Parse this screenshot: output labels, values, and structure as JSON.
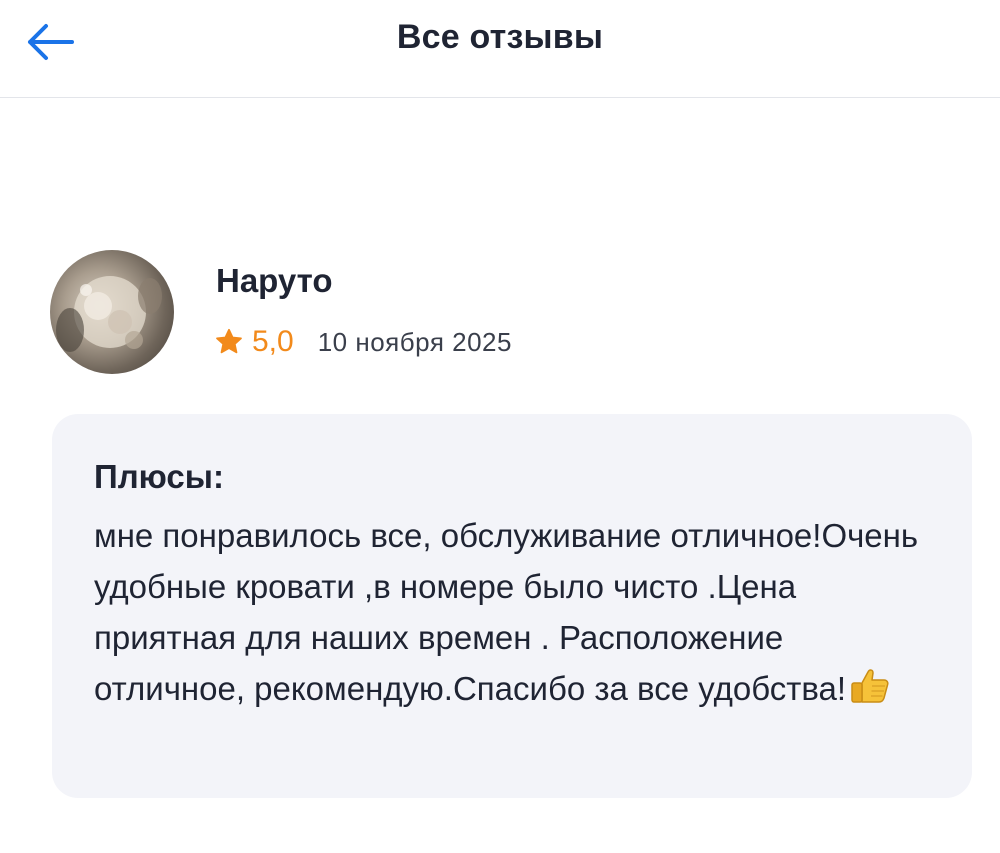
{
  "header": {
    "title": "Все отзывы",
    "back_icon": "arrow-left-icon",
    "accent": "#1a73e8"
  },
  "review": {
    "author": "Наруто",
    "avatar_icon": "user-avatar",
    "rating": "5,0",
    "rating_icon": "star-icon",
    "rating_color": "#f28a1b",
    "date": "10 ноября 2025",
    "pros_label": "Плюсы:",
    "pros_text": "мне понравилось все, обслуживание отличное!Очень удобные кровати ,в номере было чисто .Цена приятная для наших времен . Расположение отличное, рекомендую.Спасибо за все удобства!",
    "emoji_icon": "thumbs-up-icon"
  }
}
